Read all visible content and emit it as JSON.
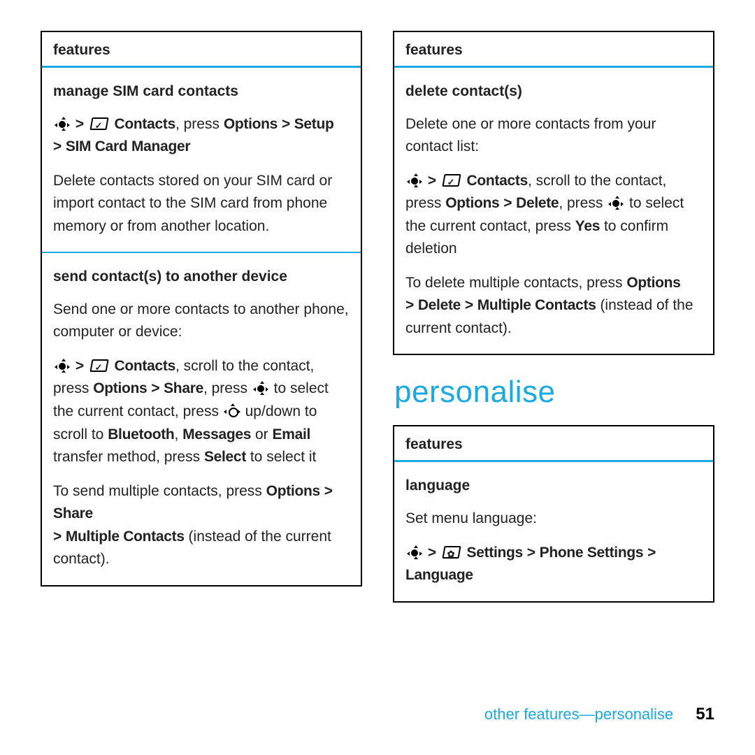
{
  "colors": {
    "accent": "#1ba9e1"
  },
  "left": {
    "header": "features",
    "sec1": {
      "title": "manage SIM card contacts",
      "navline": {
        "gt1": ">",
        "contacts": "Contacts",
        "press": ", press",
        "options": "Options",
        "gt2": ">",
        "setup": "Setup",
        "gt3": ">",
        "sim": "SIM Card Manager"
      },
      "body": "Delete contacts stored on your SIM card or import contact to the SIM card from phone memory or from another location."
    },
    "sec2": {
      "title": "send contact(s) to another device",
      "intro": "Send one or more contacts to another phone, computer or device:",
      "p1": {
        "gt1": ">",
        "contacts": "Contacts",
        "t1": ", scroll to the contact, press ",
        "options": "Options",
        "gt2": ">",
        "share": "Share",
        "t2": ", press ",
        "t3": " to select the current contact, press ",
        "t4": " up/down to scroll to ",
        "bt": "Bluetooth",
        "comma1": ", ",
        "msg": "Messages",
        "or": " or ",
        "email": "Email",
        "t5": " transfer method, press ",
        "select": "Select",
        "t6": " to select it"
      },
      "p2": {
        "t1": "To send multiple contacts, press ",
        "options": "Options",
        "gt1": ">",
        "share": "Share",
        "gt2": ">",
        "mc": "Multiple Contacts",
        "t2": " (instead of the current contact)."
      }
    }
  },
  "right": {
    "header": "features",
    "sec1": {
      "title": "delete contact(s)",
      "intro": "Delete one or more contacts from your contact list:",
      "p1": {
        "gt1": ">",
        "contacts": "Contacts",
        "t1": ", scroll to the contact, press ",
        "options": "Options",
        "gt2": ">",
        "delete": "Delete",
        "t2": ", press ",
        "t3": " to select the current contact, press ",
        "yes": "Yes",
        "t4": " to confirm deletion"
      },
      "p2": {
        "t1": "To delete multiple contacts, press ",
        "options": "Options",
        "gt1": ">",
        "delete": "Delete",
        "gt2": ">",
        "mc": "Multiple Contacts",
        "t2": " (instead of the current contact)."
      }
    },
    "personalise_heading": "personalise",
    "box2": {
      "header": "features",
      "sec1": {
        "title": "language",
        "intro": "Set menu language:",
        "nav": {
          "gt1": ">",
          "settings": "Settings",
          "gt2": ">",
          "ps": "Phone Settings",
          "gt3": ">",
          "lang": "Language"
        }
      }
    }
  },
  "footer": {
    "crumb": "other features—personalise",
    "page": "51"
  }
}
